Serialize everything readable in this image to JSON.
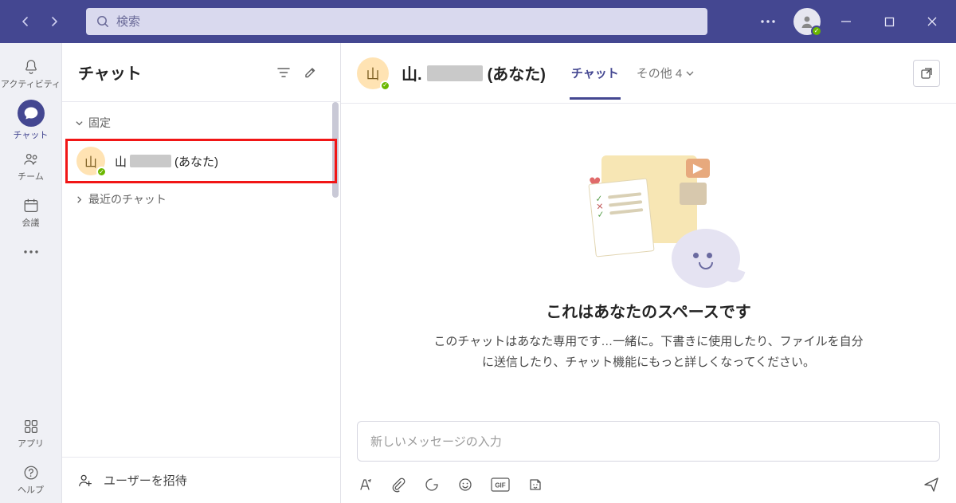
{
  "search": {
    "placeholder": "検索"
  },
  "rail": {
    "activity": "アクティビティ",
    "chat": "チャット",
    "team": "チーム",
    "meeting": "会議",
    "apps": "アプリ",
    "help": "ヘルプ"
  },
  "pane": {
    "title": "チャット",
    "section_pinned": "固定",
    "section_recent": "最近のチャット",
    "item_avatar_initial": "山",
    "item_prefix": "山",
    "item_suffix": "(あなた)",
    "invite": "ユーザーを招待"
  },
  "main": {
    "avatar_initial": "山",
    "title_prefix": "山.",
    "title_suffix": "(あなた)",
    "tab_chat": "チャット",
    "tab_others": "その他 4",
    "empty_title": "これはあなたのスペースです",
    "empty_desc": "このチャットはあなた専用です…一緒に。下書きに使用したり、ファイルを自分に送信したり、チャット機能にもっと詳しくなってください。",
    "compose_placeholder": "新しいメッセージの入力"
  }
}
